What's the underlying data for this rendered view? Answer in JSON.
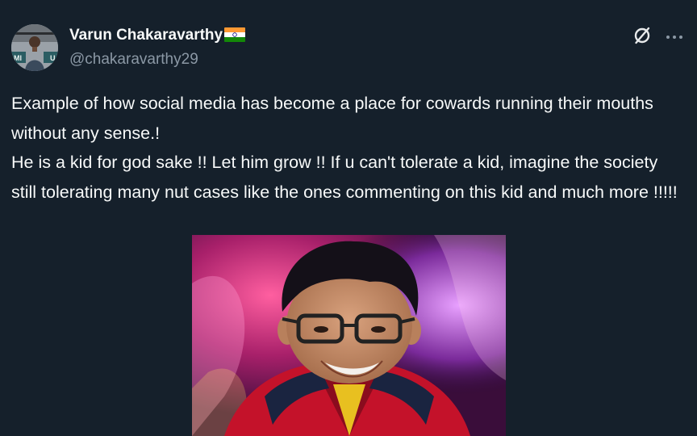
{
  "post": {
    "author": {
      "display_name": "Varun Chakaravarthy",
      "handle": "@chakaravarthy29",
      "verified_badge": "india-flag-emoji",
      "avatar": "profile-avatar"
    },
    "actions": {
      "grok_icon": "grok-slash-circle-icon",
      "more_icon": "more-dots-icon"
    },
    "text": {
      "paragraph_1": "Example of how social media has become a place for cowards running their mouths without any sense.!",
      "paragraph_2": "He is a kid for god sake !! Let him grow !! If u can't tolerate a kid, imagine the society still tolerating many nut cases like the ones commenting on this kid and much more !!!!!"
    },
    "media": {
      "type": "photo",
      "subject": "boy-with-glasses-photo"
    }
  },
  "colors": {
    "background": "#15202b",
    "primary_text": "#f7f9f9",
    "secondary_text": "#8b98a5"
  }
}
